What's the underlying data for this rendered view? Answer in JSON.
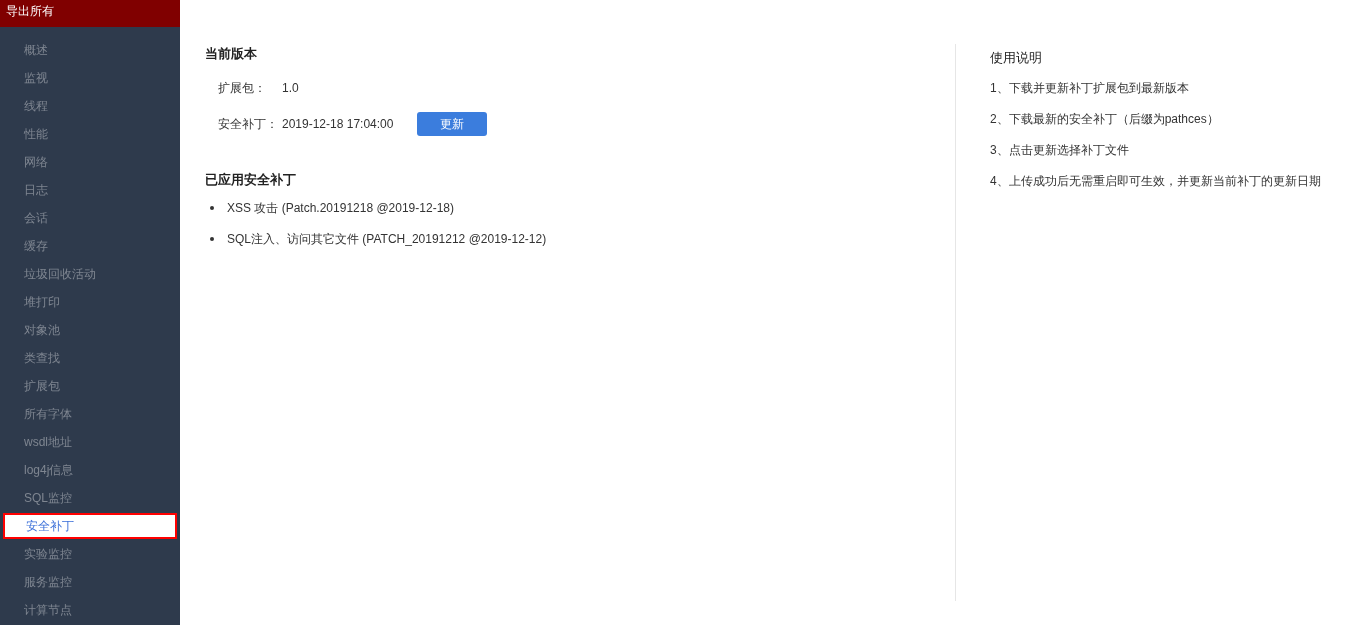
{
  "sidebar": {
    "header": "导出所有",
    "items": [
      {
        "label": "概述",
        "selected": false
      },
      {
        "label": "监视",
        "selected": false
      },
      {
        "label": "线程",
        "selected": false
      },
      {
        "label": "性能",
        "selected": false
      },
      {
        "label": "网络",
        "selected": false
      },
      {
        "label": "日志",
        "selected": false
      },
      {
        "label": "会话",
        "selected": false
      },
      {
        "label": "缓存",
        "selected": false
      },
      {
        "label": "垃圾回收活动",
        "selected": false
      },
      {
        "label": "堆打印",
        "selected": false
      },
      {
        "label": "对象池",
        "selected": false
      },
      {
        "label": "类查找",
        "selected": false
      },
      {
        "label": "扩展包",
        "selected": false
      },
      {
        "label": "所有字体",
        "selected": false
      },
      {
        "label": "wsdl地址",
        "selected": false
      },
      {
        "label": "log4j信息",
        "selected": false
      },
      {
        "label": "SQL监控",
        "selected": false
      },
      {
        "label": "安全补丁",
        "selected": true
      },
      {
        "label": "实验监控",
        "selected": false
      },
      {
        "label": "服务监控",
        "selected": false
      },
      {
        "label": "计算节点",
        "selected": false
      }
    ]
  },
  "current_version": {
    "title": "当前版本",
    "fields": [
      {
        "label": "扩展包：",
        "value": "1.0"
      },
      {
        "label": "安全补丁：",
        "value": "2019-12-18 17:04:00",
        "button": "更新"
      }
    ]
  },
  "applied_patches": {
    "title": "已应用安全补丁",
    "items": [
      "XSS 攻击 (Patch.20191218 @2019-12-18)",
      "SQL注入、访问其它文件 (PATCH_20191212 @2019-12-12)"
    ]
  },
  "instructions": {
    "title": "使用说明",
    "steps": [
      "1、下载并更新补丁扩展包到最新版本",
      "2、下载最新的安全补丁（后缀为pathces）",
      "3、点击更新选择补丁文件",
      "4、上传成功后无需重启即可生效，并更新当前补丁的更新日期"
    ]
  }
}
